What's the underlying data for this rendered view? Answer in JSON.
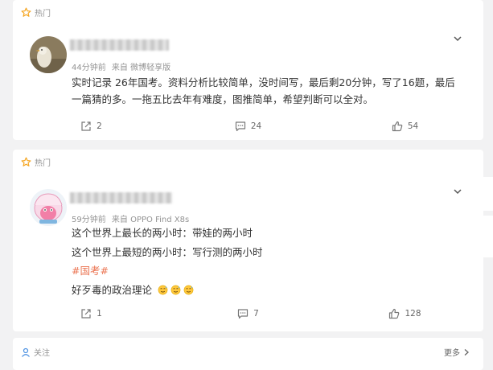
{
  "posts": [
    {
      "badge": "热门",
      "meta_time": "44分钟前",
      "meta_source": "来自 微博轻享版",
      "lines": [
        "实时记录 26年国考。资料分析比较简单，没时间写，最后剩20分钟，写了16题，最后",
        "一篇猜的多。一拖五比去年有难度，图推简单，希望判断可以全对。"
      ],
      "repost_count": "2",
      "comment_count": "24",
      "like_count": "54"
    },
    {
      "badge": "热门",
      "meta_time": "59分钟前",
      "meta_source": "来自 OPPO Find X8s",
      "lines": [
        "这个世界上最长的两小时：带娃的两小时",
        "这个世界上最短的两小时：写行测的两小时"
      ],
      "topic": "#国考#",
      "last_line": "好歹毒的政治理论",
      "emoji": [
        "sweat-smile-emoji",
        "sweat-smile-emoji",
        "sweat-smile-emoji"
      ],
      "repost_count": "1",
      "comment_count": "7",
      "like_count": "128"
    }
  ],
  "next_card": {
    "label": "关注",
    "more": "更多"
  },
  "colors": {
    "topic": "#eb7350",
    "badge_star": "#f5a623",
    "meta": "#939393",
    "background": "#f2f2f3"
  }
}
